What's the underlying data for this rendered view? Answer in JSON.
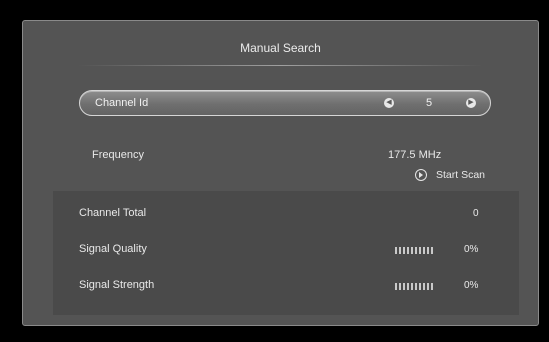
{
  "dialog": {
    "title": "Manual Search"
  },
  "channel": {
    "label": "Channel Id",
    "value": "5",
    "prev_icon": "chevron-left-icon",
    "next_icon": "chevron-right-icon"
  },
  "frequency": {
    "label": "Frequency",
    "value": "177.5  MHz"
  },
  "scan": {
    "label": "Start Scan",
    "icon": "play-circle-icon"
  },
  "stats": {
    "channel_total": {
      "label": "Channel Total",
      "value": "0"
    },
    "signal_quality": {
      "label": "Signal Quality",
      "value": "0%",
      "level": 0
    },
    "signal_strength": {
      "label": "Signal Strength",
      "value": "0%",
      "level": 0
    }
  },
  "colors": {
    "background": "#000000",
    "panel": "#545454",
    "stats_panel": "#4a4a4a",
    "text": "#e6e6e6"
  }
}
